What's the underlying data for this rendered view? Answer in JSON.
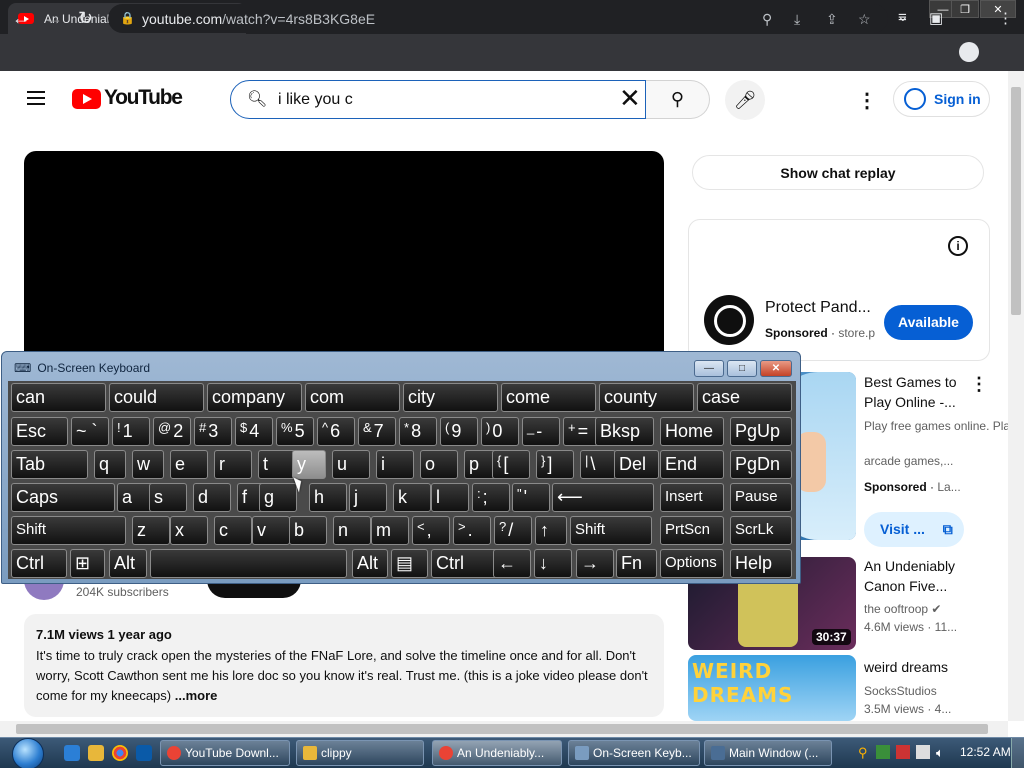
{
  "browser": {
    "tab_title": "An Undeniably Canon Five Nights",
    "speaker_icon": "speaker-icon",
    "close_tab": "✕",
    "new_tab": "+",
    "url_host": "youtube.com",
    "url_path": "/watch?v=4rs8B3KG8eE",
    "win_min": "—",
    "win_max": "❐",
    "win_close": "✕"
  },
  "youtube": {
    "logo_text": "YouTube",
    "search_query": "i like you c",
    "sign_in": "Sign in",
    "chat_replay": "Show chat replay",
    "ad": {
      "title": "Protect Pand...",
      "sponsored": "Sponsored",
      "domain": "store.p",
      "cta": "Available"
    },
    "recommendations": [
      {
        "title": "Best Games to Play Online -...",
        "meta1": "Play free games online. Play",
        "meta2": "arcade games,...",
        "sponsored": "Sponsored",
        "domain": "La...",
        "cta": "Visit ..."
      },
      {
        "title": "An Undeniably Canon Five...",
        "channel": "the ooftroop",
        "meta": "4.6M views · 11...",
        "duration": "30:37"
      },
      {
        "title": "weird dreams",
        "channel": "SocksStudios",
        "meta": "3.5M views · 4..."
      }
    ],
    "subscribers": "204K subscribers",
    "description": {
      "views": "7.1M views  1 year ago",
      "text": "It's time to truly crack open the mysteries of the FNaF Lore, and solve the timeline once and for all. Don't worry, Scott Cawthon sent me his lore doc so you know it's real. Trust me. (this is a joke video please don't come for my kneecaps)",
      "more": "...more"
    }
  },
  "osk": {
    "title": "On-Screen Keyboard",
    "predictions": [
      "can",
      "could",
      "company",
      "com",
      "city",
      "come",
      "county",
      "case"
    ],
    "row1": [
      [
        "Esc",
        ""
      ],
      [
        "~ `",
        ""
      ],
      [
        "1",
        "!"
      ],
      [
        "2",
        "@"
      ],
      [
        "3",
        "#"
      ],
      [
        "4",
        "$"
      ],
      [
        "5",
        "%"
      ],
      [
        "6",
        "^"
      ],
      [
        "7",
        "&"
      ],
      [
        "8",
        "*"
      ],
      [
        "9",
        "("
      ],
      [
        "0",
        ")"
      ],
      [
        "-",
        "_"
      ],
      [
        "=",
        "+"
      ],
      [
        "Bksp",
        ""
      ],
      [
        "Home",
        ""
      ],
      [
        "PgUp",
        ""
      ]
    ],
    "row2": [
      [
        "Tab",
        ""
      ],
      [
        "q",
        ""
      ],
      [
        "w",
        ""
      ],
      [
        "e",
        ""
      ],
      [
        "r",
        ""
      ],
      [
        "t",
        ""
      ],
      [
        "y",
        ""
      ],
      [
        "u",
        ""
      ],
      [
        "i",
        ""
      ],
      [
        "o",
        ""
      ],
      [
        "p",
        ""
      ],
      [
        "[",
        "{"
      ],
      [
        "]",
        "}"
      ],
      [
        "\\",
        "|"
      ],
      [
        "Del",
        ""
      ],
      [
        "End",
        ""
      ],
      [
        "PgDn",
        ""
      ]
    ],
    "row3": [
      [
        "Caps",
        ""
      ],
      [
        "a",
        ""
      ],
      [
        "s",
        ""
      ],
      [
        "d",
        ""
      ],
      [
        "f",
        ""
      ],
      [
        "g",
        ""
      ],
      [
        "h",
        ""
      ],
      [
        "j",
        ""
      ],
      [
        "k",
        ""
      ],
      [
        "l",
        ""
      ],
      [
        ";",
        ":"
      ],
      [
        "'",
        "\""
      ],
      [
        "⟵",
        ""
      ],
      [
        "Insert",
        ""
      ],
      [
        "Pause",
        ""
      ]
    ],
    "row4": [
      [
        "Shift",
        ""
      ],
      [
        "z",
        ""
      ],
      [
        "x",
        ""
      ],
      [
        "c",
        ""
      ],
      [
        "v",
        ""
      ],
      [
        "b",
        ""
      ],
      [
        "n",
        ""
      ],
      [
        "m",
        ""
      ],
      [
        ",",
        "<"
      ],
      [
        ".",
        ">"
      ],
      [
        "/",
        "?"
      ],
      [
        "↑",
        ""
      ],
      [
        "Shift",
        ""
      ],
      [
        "PrtScn",
        ""
      ],
      [
        "ScrLk",
        ""
      ]
    ],
    "row5": [
      [
        "Ctrl",
        ""
      ],
      [
        "⊞",
        ""
      ],
      [
        "Alt",
        ""
      ],
      [
        "",
        ""
      ],
      [
        "Alt",
        ""
      ],
      [
        "▤",
        ""
      ],
      [
        "Ctrl",
        ""
      ],
      [
        "←",
        ""
      ],
      [
        "↓",
        ""
      ],
      [
        "→",
        ""
      ],
      [
        "Fn",
        ""
      ],
      [
        "Options",
        ""
      ],
      [
        "Help",
        ""
      ]
    ]
  },
  "taskbar": {
    "tasks": [
      "YouTube Downl...",
      "clippy",
      "An Undeniably...",
      "On-Screen Keyb...",
      "Main Window (..."
    ],
    "clock": "12:52 AM"
  }
}
